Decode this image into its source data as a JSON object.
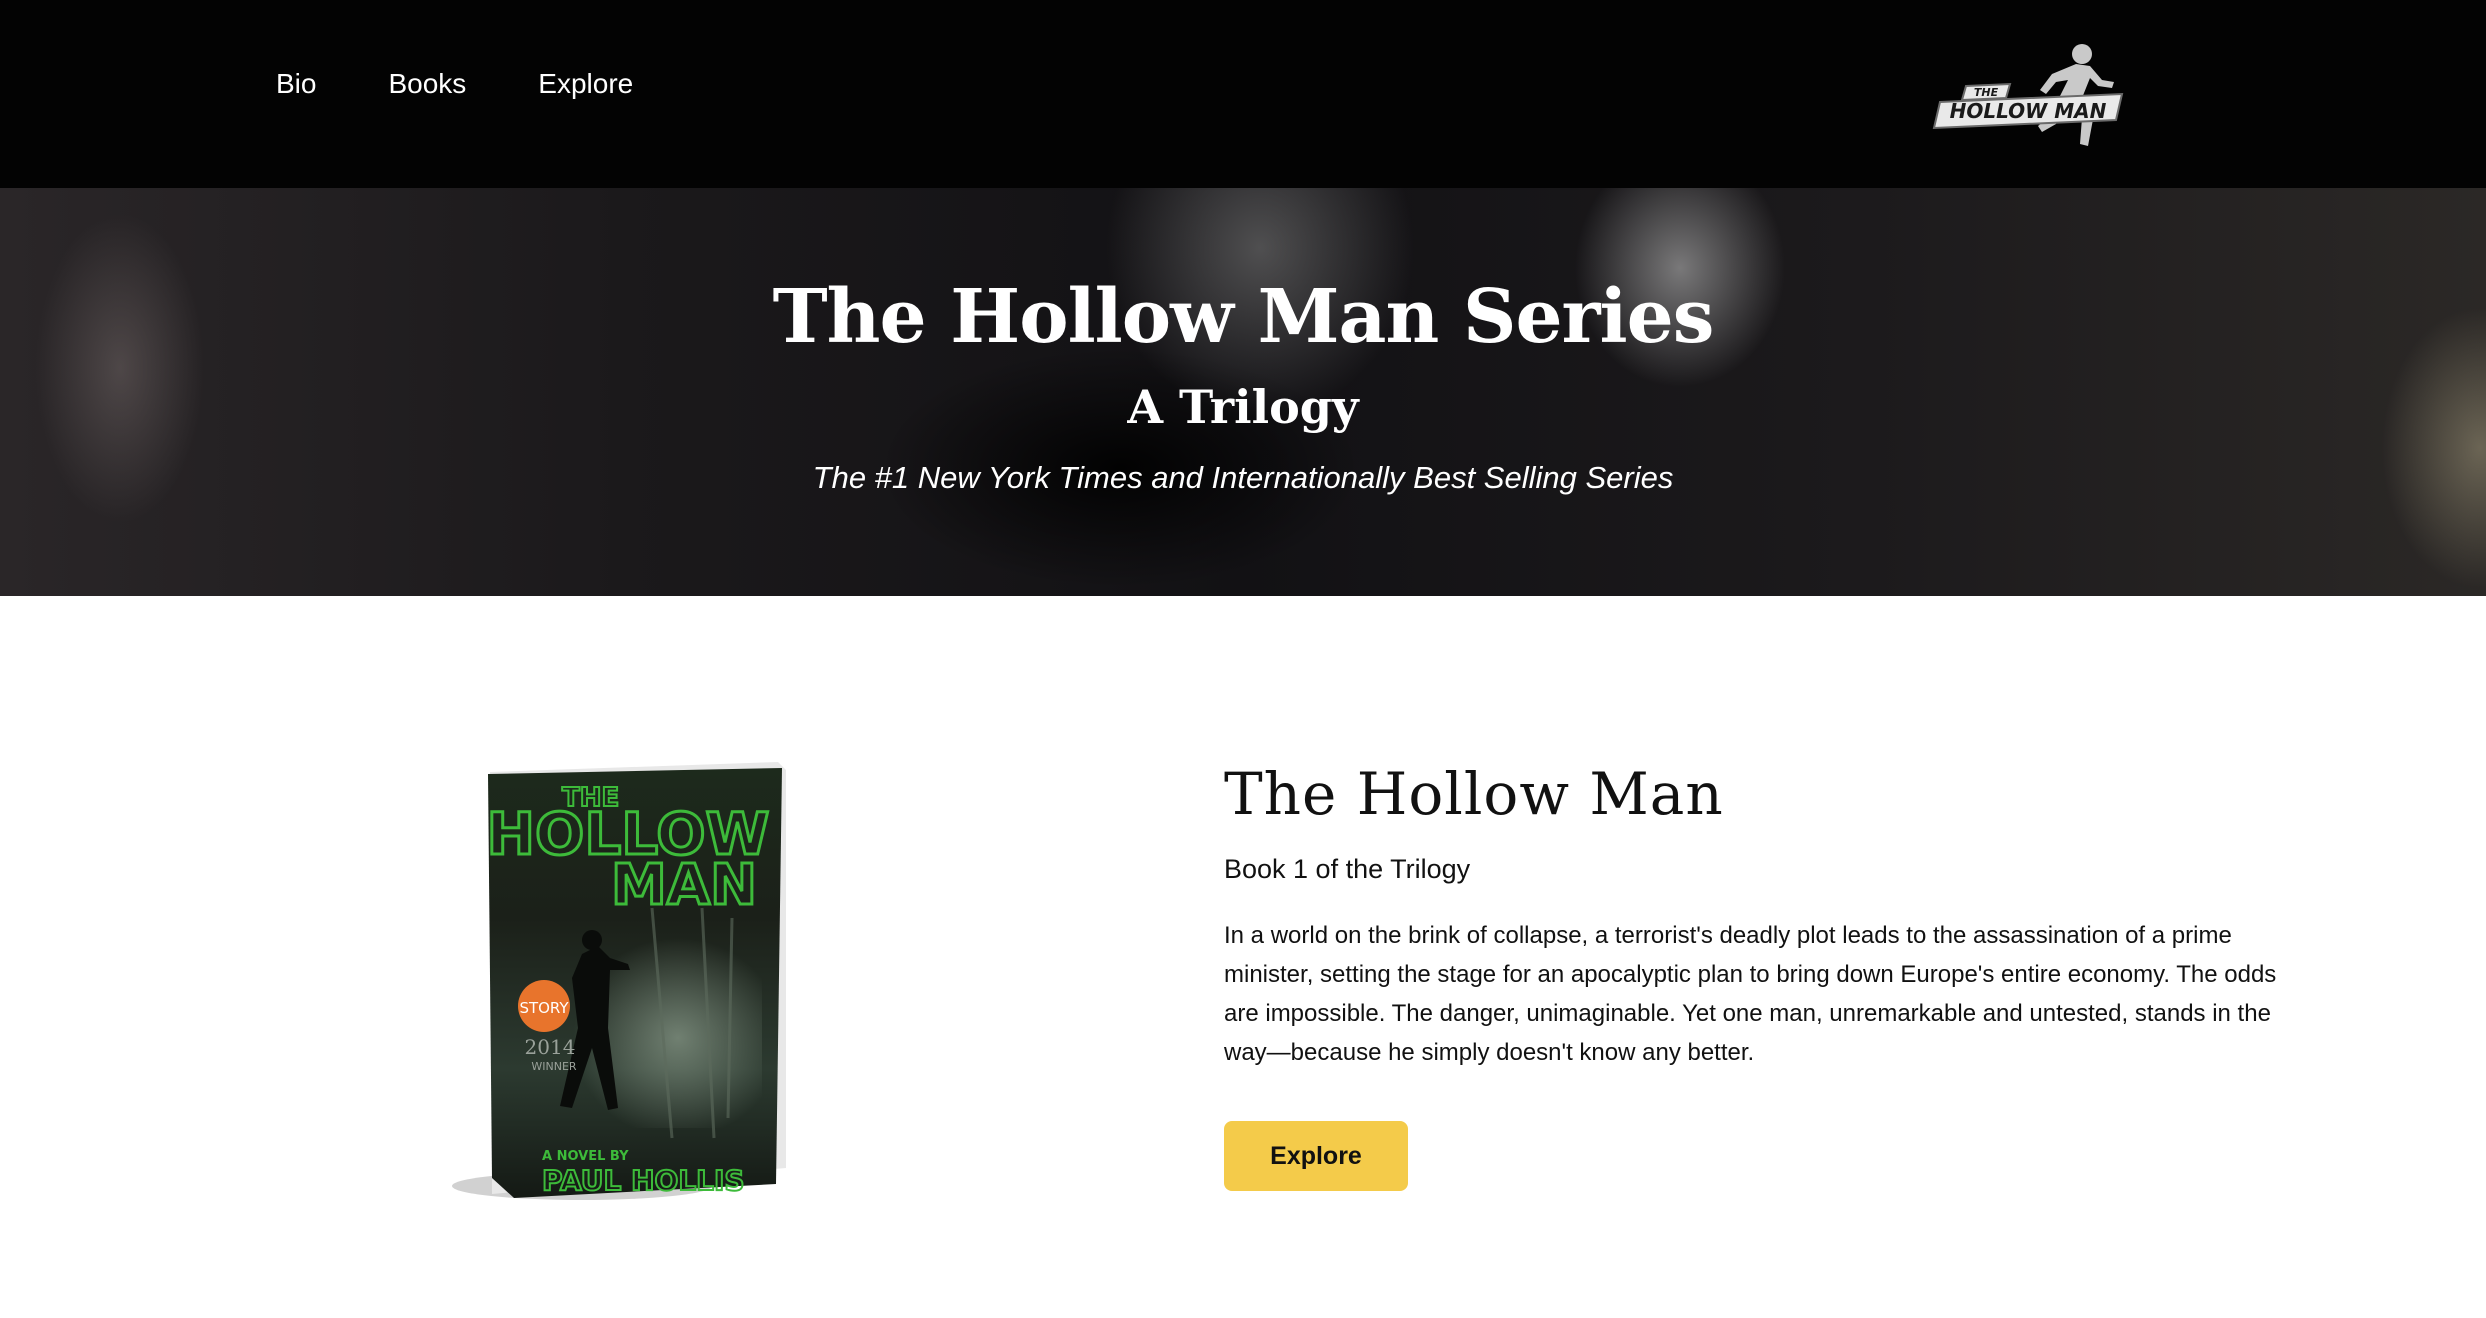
{
  "nav": {
    "items": [
      {
        "label": "Bio"
      },
      {
        "label": "Books"
      },
      {
        "label": "Explore"
      }
    ]
  },
  "logo": {
    "line1": "THE",
    "line2": "HOLLOW MAN",
    "icon": "running-man-logo-icon"
  },
  "hero": {
    "title": "The Hollow Man Series",
    "subtitle": "A Trilogy",
    "tagline": "The #1 New York Times and Internationally Best Selling Series"
  },
  "book": {
    "title": "The Hollow Man",
    "subtitle": "Book 1 of the Trilogy",
    "description": "In a world on the brink of collapse, a terrorist's deadly plot leads to the assassination of a prime minister, setting the stage for an apocalyptic plan to bring down Europe's entire economy. The odds are impossible. The danger, unimaginable. Yet one man, unremarkable and untested, stands in the way—because he simply doesn't know any better.",
    "button_label": "Explore",
    "cover": {
      "title_line1": "THE",
      "title_line2": "HOLLOW",
      "title_line3": "MAN",
      "badge": "STORY",
      "award_year": "2014",
      "award_text": "WINNER",
      "byline": "A NOVEL BY",
      "author": "PAUL HOLLIS"
    }
  },
  "colors": {
    "header_bg": "#030303",
    "button_bg": "#f4cb4a",
    "cover_green": "#3dbb3a",
    "badge_orange": "#e8742c"
  }
}
